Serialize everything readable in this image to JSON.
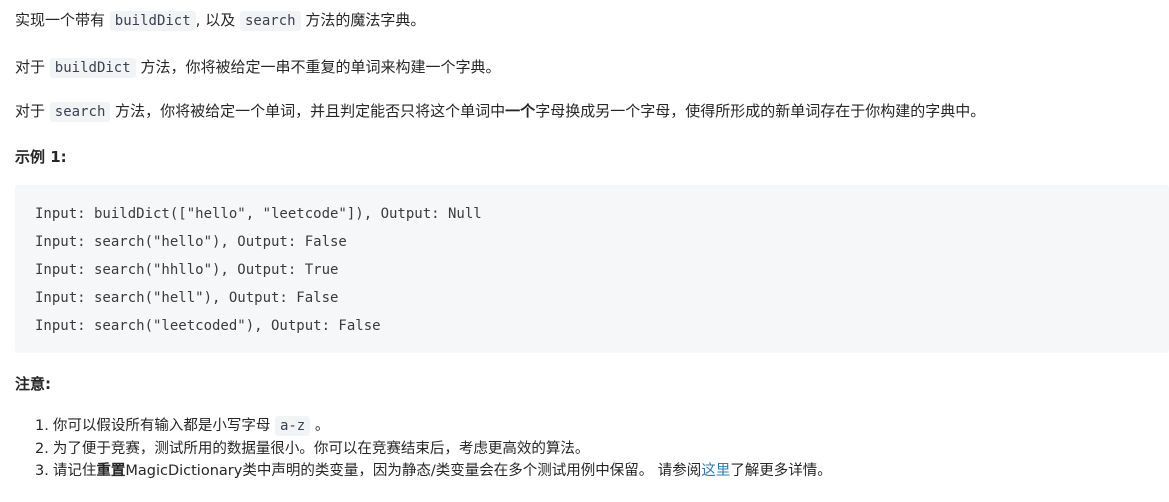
{
  "intro": {
    "p1_a": "实现一个带有",
    "p1_code1": "buildDict",
    "p1_b": ", 以及",
    "p1_code2": "search",
    "p1_c": "方法的魔法字典。",
    "p2_a": "对于",
    "p2_code": "buildDict",
    "p2_b": "方法，你将被给定一串不重复的单词来构建一个字典。",
    "p3_a": "对于",
    "p3_code": "search",
    "p3_b": "方法，你将被给定一个单词，并且判定能否只将这个单词中",
    "p3_bold": "一个",
    "p3_c": "字母换成另一个字母，使得所形成的新单词存在于你构建的字典中。"
  },
  "example": {
    "heading": "示例 1:",
    "lines": [
      "Input: buildDict([\"hello\", \"leetcode\"]), Output: Null",
      "Input: search(\"hello\"), Output: False",
      "Input: search(\"hhllo\"), Output: True",
      "Input: search(\"hell\"), Output: False",
      "Input: search(\"leetcoded\"), Output: False"
    ]
  },
  "notes": {
    "heading": "注意:",
    "items": [
      {
        "num": "1.",
        "text_a": "你可以假设所有输入都是小写字母",
        "code": "a-z",
        "text_b": "。"
      },
      {
        "num": "2.",
        "text_a": "为了便于竞赛，测试所用的数据量很小。你可以在竞赛结束后，考虑更高效的算法。"
      },
      {
        "num": "3.",
        "text_a": "请记住",
        "bold": "重置",
        "text_b": "MagicDictionary类中声明的类变量，因为静态/类变量会在多个测试用例中保留。 请参阅",
        "link": "这里",
        "text_c": "了解更多详情。"
      }
    ]
  },
  "colors": {
    "text": "#262626",
    "code_bg": "#f6f7f9",
    "inline_code_bg": "#f2f3f5",
    "link": "#2f7ab8"
  }
}
